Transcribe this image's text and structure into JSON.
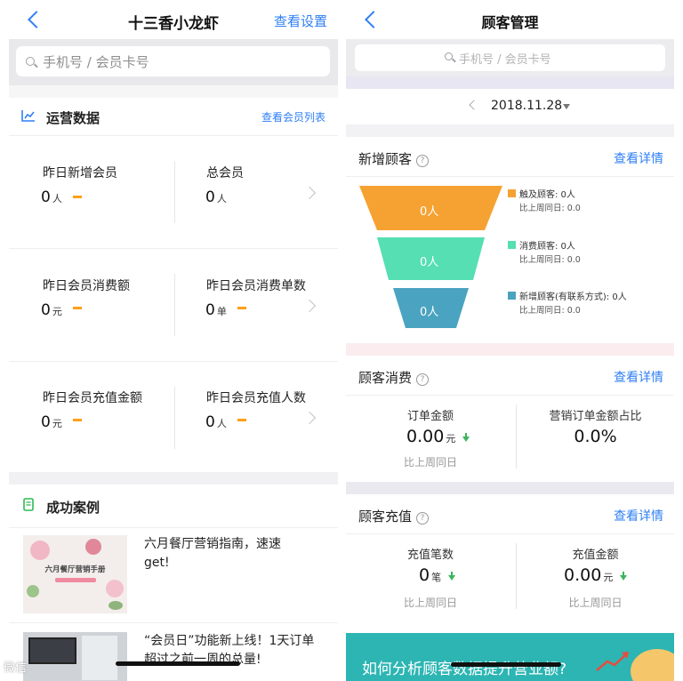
{
  "left": {
    "header": {
      "title": "十三香小龙虾",
      "right_link": "查看设置"
    },
    "search": {
      "placeholder": "手机号 / 会员卡号"
    },
    "ops": {
      "title": "运营数据",
      "link": "查看会员列表",
      "rows": [
        {
          "a_label": "昨日新增会员",
          "a_value": "0",
          "a_unit": "人",
          "b_label": "总会员",
          "b_value": "0",
          "b_unit": "人"
        },
        {
          "a_label": "昨日会员消费额",
          "a_value": "0",
          "a_unit": "元",
          "b_label": "昨日会员消费单数",
          "b_value": "0",
          "b_unit": "单"
        },
        {
          "a_label": "昨日会员充值金额",
          "a_value": "0",
          "a_unit": "元",
          "b_label": "昨日会员充值人数",
          "b_value": "0",
          "b_unit": "人"
        }
      ]
    },
    "cases": {
      "title": "成功案例",
      "items": [
        {
          "thumb_text": "六月餐厅营销手册",
          "title": "六月餐厅营销指南，速速get!"
        },
        {
          "title": "“会员日”功能新上线！1天订单超过之前一周的总量!"
        }
      ]
    }
  },
  "right": {
    "header": {
      "title": "顾客管理"
    },
    "search": {
      "placeholder": "手机号 / 会员卡号"
    },
    "date": "2018.11.28",
    "new_customers": {
      "title": "新增顾客",
      "link": "查看详情",
      "funnel": [
        {
          "value": "0人",
          "legend": "触及顾客: 0人",
          "compare": "比上周同日: 0.0",
          "color": "#f6a233"
        },
        {
          "value": "0人",
          "legend": "消费顾客: 0人",
          "compare": "比上周同日: 0.0",
          "color": "#55dfb3"
        },
        {
          "value": "0人",
          "legend": "新增顾客(有联系方式): 0人",
          "compare": "比上周同日: 0.0",
          "color": "#4aa3c0"
        }
      ]
    },
    "consumption": {
      "title": "顾客消费",
      "link": "查看详情",
      "left": {
        "label": "订单金额",
        "value": "0.00",
        "unit": "元",
        "compare": "比上周同日"
      },
      "right": {
        "label": "营销订单金额占比",
        "value": "0.0%"
      }
    },
    "recharge": {
      "title": "顾客充值",
      "link": "查看详情",
      "left": {
        "label": "充值笔数",
        "value": "0",
        "unit": "笔",
        "compare": "比上周同日"
      },
      "right": {
        "label": "充值金额",
        "value": "0.00",
        "unit": "元",
        "compare": "比上周同日"
      }
    },
    "banner": {
      "text": "如何分析顾客数据提升营业额?"
    }
  },
  "watermark": "微信"
}
